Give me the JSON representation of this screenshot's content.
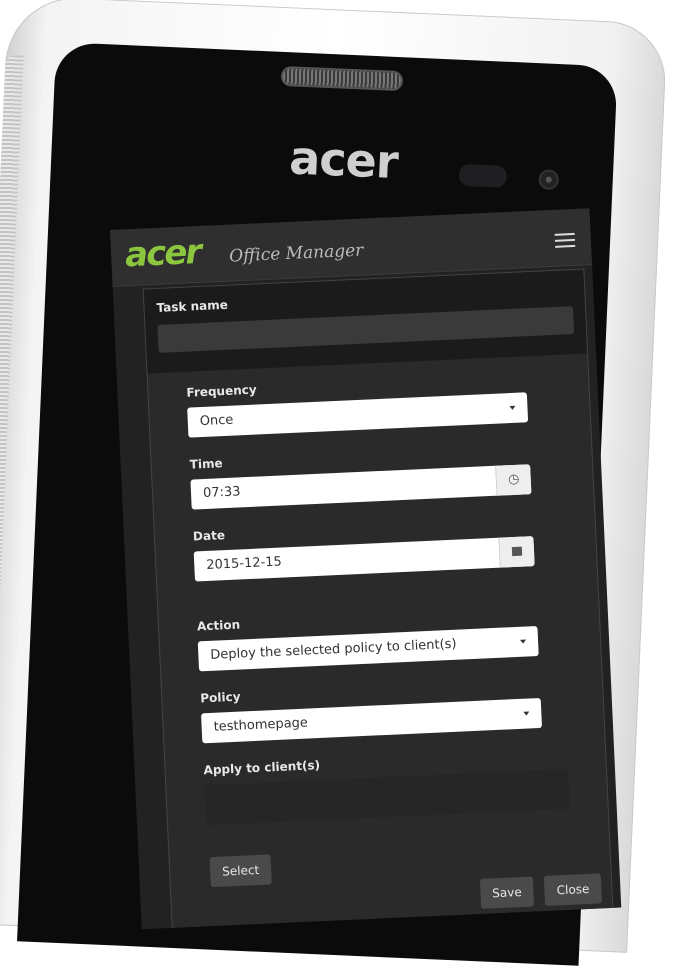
{
  "device": {
    "phone_logo": "acer"
  },
  "app": {
    "brand": "acer",
    "title": "Office Manager",
    "accent": "#8cc63f",
    "menu_icon": "hamburger-icon"
  },
  "form": {
    "task_name_label": "Task name",
    "task_name_value": "",
    "frequency_label": "Frequency",
    "frequency_value": "Once",
    "time_label": "Time",
    "time_value": "07:33",
    "time_icon": "clock-icon",
    "date_label": "Date",
    "date_value": "2015-12-15",
    "date_icon": "calendar-icon",
    "action_label": "Action",
    "action_value": "Deploy the selected policy to client(s)",
    "policy_label": "Policy",
    "policy_value": "testhomepage",
    "apply_label": "Apply to client(s)",
    "select_button": "Select",
    "save_button": "Save",
    "close_button": "Close"
  }
}
